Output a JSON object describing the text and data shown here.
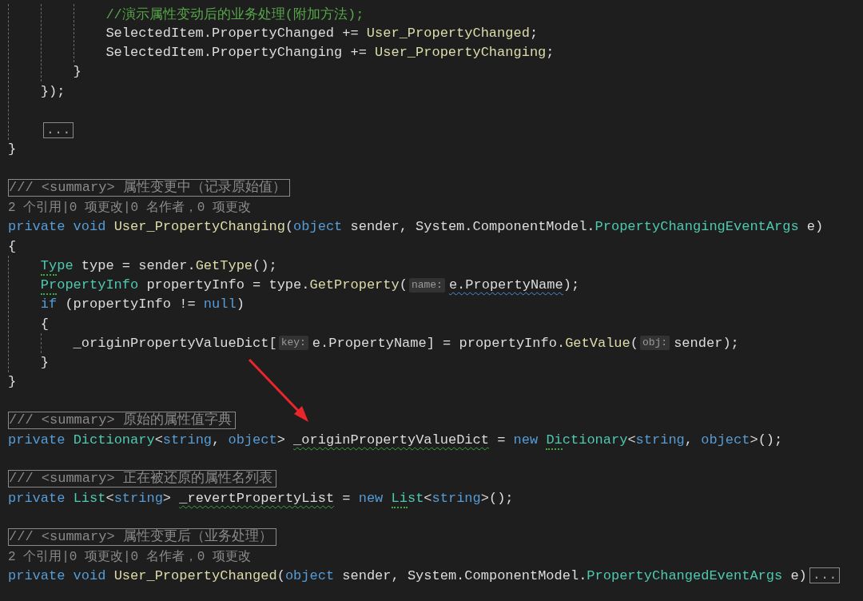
{
  "editor": {
    "lines": [
      {
        "kind": "block",
        "children": [
          {
            "kind": "block",
            "children": [
              {
                "kind": "block",
                "children": [
                  {
                    "kind": "code",
                    "tokens": [
                      {
                        "t": "//演示属性变动后的业务处理(附加方法);",
                        "kind": "comment"
                      }
                    ]
                  },
                  {
                    "kind": "code",
                    "tokens": [
                      {
                        "t": "SelectedItem.PropertyChanged += ",
                        "kind": "plain"
                      },
                      {
                        "t": "User_PropertyChanged",
                        "kind": "method"
                      },
                      {
                        "t": ";",
                        "kind": "plain"
                      }
                    ]
                  },
                  {
                    "kind": "code",
                    "tokens": [
                      {
                        "t": "SelectedItem.PropertyChanging += ",
                        "kind": "plain"
                      },
                      {
                        "t": "User_PropertyChanging",
                        "kind": "method"
                      },
                      {
                        "t": ";",
                        "kind": "plain"
                      }
                    ]
                  }
                ]
              },
              {
                "kind": "code",
                "tokens": [
                  {
                    "t": "}",
                    "kind": "plain"
                  }
                ]
              }
            ]
          },
          {
            "kind": "code",
            "tokens": [
              {
                "t": "});",
                "kind": "plain"
              }
            ]
          },
          {
            "kind": "blank"
          },
          {
            "kind": "code",
            "tokens": [
              {
                "t": "...",
                "kind": "fold"
              }
            ]
          }
        ]
      },
      {
        "kind": "code",
        "tokens": [
          {
            "t": "}",
            "kind": "plain"
          }
        ]
      },
      {
        "kind": "blank"
      },
      {
        "kind": "code",
        "tokens": [
          {
            "t": "/// <summary> 属性变更中（记录原始值）",
            "kind": "doc"
          }
        ]
      },
      {
        "kind": "code",
        "tokens": [
          {
            "t": "2 个引用|0 项更改|0 名作者，0 项更改",
            "kind": "lens"
          }
        ]
      },
      {
        "kind": "code",
        "tokens": [
          {
            "t": "private void ",
            "kind": "keyword"
          },
          {
            "t": "User_PropertyChanging",
            "kind": "method"
          },
          {
            "t": "(",
            "kind": "plain"
          },
          {
            "t": "object",
            "kind": "keyword"
          },
          {
            "t": " sender, System.ComponentModel.",
            "kind": "plain"
          },
          {
            "t": "PropertyChangingEventArgs",
            "kind": "type"
          },
          {
            "t": " e)",
            "kind": "plain"
          }
        ]
      },
      {
        "kind": "code",
        "tokens": [
          {
            "t": "{",
            "kind": "plain"
          }
        ]
      },
      {
        "kind": "block",
        "children": [
          {
            "kind": "code",
            "tokens": [
              {
                "t": "Type",
                "kind": "type",
                "suggestion_dots": true
              },
              {
                "t": " type = sender.",
                "kind": "plain"
              },
              {
                "t": "GetType",
                "kind": "method"
              },
              {
                "t": "();",
                "kind": "plain"
              }
            ]
          },
          {
            "kind": "code",
            "tokens": [
              {
                "t": "PropertyInfo",
                "kind": "type",
                "suggestion_dots": true
              },
              {
                "t": " propertyInfo = type.",
                "kind": "plain"
              },
              {
                "t": "GetProperty",
                "kind": "method"
              },
              {
                "t": "(",
                "kind": "plain"
              },
              {
                "t": "name:",
                "kind": "hint"
              },
              {
                "t": "e.PropertyName",
                "kind": "plain",
                "info_squiggle": true
              },
              {
                "t": ");",
                "kind": "plain"
              }
            ]
          },
          {
            "kind": "code",
            "tokens": [
              {
                "t": "if",
                "kind": "keyword"
              },
              {
                "t": " (propertyInfo != ",
                "kind": "plain"
              },
              {
                "t": "null",
                "kind": "keyword"
              },
              {
                "t": ")",
                "kind": "plain"
              }
            ]
          },
          {
            "kind": "code",
            "tokens": [
              {
                "t": "{",
                "kind": "plain"
              }
            ]
          },
          {
            "kind": "block",
            "children": [
              {
                "kind": "code",
                "tokens": [
                  {
                    "t": "_originPropertyValueDict[",
                    "kind": "plain"
                  },
                  {
                    "t": "key:",
                    "kind": "hint"
                  },
                  {
                    "t": "e.PropertyName] = propertyInfo.",
                    "kind": "plain"
                  },
                  {
                    "t": "GetValue",
                    "kind": "method"
                  },
                  {
                    "t": "(",
                    "kind": "plain"
                  },
                  {
                    "t": "obj:",
                    "kind": "hint"
                  },
                  {
                    "t": "sender);",
                    "kind": "plain"
                  }
                ]
              }
            ]
          },
          {
            "kind": "code",
            "tokens": [
              {
                "t": "}",
                "kind": "plain"
              }
            ]
          }
        ]
      },
      {
        "kind": "code",
        "tokens": [
          {
            "t": "}",
            "kind": "plain"
          }
        ]
      },
      {
        "kind": "blank"
      },
      {
        "kind": "code",
        "tokens": [
          {
            "t": "/// <summary> 原始的属性值字典",
            "kind": "doc"
          }
        ]
      },
      {
        "kind": "code",
        "tokens": [
          {
            "t": "private ",
            "kind": "keyword"
          },
          {
            "t": "Dictionary",
            "kind": "type"
          },
          {
            "t": "<",
            "kind": "plain"
          },
          {
            "t": "string",
            "kind": "keyword"
          },
          {
            "t": ", ",
            "kind": "plain"
          },
          {
            "t": "object",
            "kind": "keyword"
          },
          {
            "t": "> ",
            "kind": "plain"
          },
          {
            "t": "_originPropertyValueDict",
            "kind": "plain",
            "warning_squiggle": true
          },
          {
            "t": " = ",
            "kind": "plain"
          },
          {
            "t": "new ",
            "kind": "keyword"
          },
          {
            "t": "Dictionary",
            "kind": "type",
            "suggestion_dots": true
          },
          {
            "t": "<",
            "kind": "plain"
          },
          {
            "t": "string",
            "kind": "keyword"
          },
          {
            "t": ", ",
            "kind": "plain"
          },
          {
            "t": "object",
            "kind": "keyword"
          },
          {
            "t": ">();",
            "kind": "plain"
          }
        ]
      },
      {
        "kind": "blank"
      },
      {
        "kind": "code",
        "tokens": [
          {
            "t": "/// <summary> 正在被还原的属性名列表",
            "kind": "doc"
          }
        ]
      },
      {
        "kind": "code",
        "tokens": [
          {
            "t": "private ",
            "kind": "keyword"
          },
          {
            "t": "List",
            "kind": "type"
          },
          {
            "t": "<",
            "kind": "plain"
          },
          {
            "t": "string",
            "kind": "keyword"
          },
          {
            "t": "> ",
            "kind": "plain"
          },
          {
            "t": "_revertPropertyList",
            "kind": "plain",
            "warning_squiggle": true
          },
          {
            "t": " = ",
            "kind": "plain"
          },
          {
            "t": "new ",
            "kind": "keyword"
          },
          {
            "t": "List",
            "kind": "type",
            "suggestion_dots": true
          },
          {
            "t": "<",
            "kind": "plain"
          },
          {
            "t": "string",
            "kind": "keyword"
          },
          {
            "t": ">();",
            "kind": "plain"
          }
        ]
      },
      {
        "kind": "blank"
      },
      {
        "kind": "code",
        "tokens": [
          {
            "t": "/// <summary> 属性变更后（业务处理）",
            "kind": "doc"
          }
        ]
      },
      {
        "kind": "code",
        "tokens": [
          {
            "t": "2 个引用|0 项更改|0 名作者，0 项更改",
            "kind": "lens"
          }
        ]
      },
      {
        "kind": "code",
        "tokens": [
          {
            "t": "private void ",
            "kind": "keyword"
          },
          {
            "t": "User_PropertyChanged",
            "kind": "method"
          },
          {
            "t": "(",
            "kind": "plain"
          },
          {
            "t": "object",
            "kind": "keyword"
          },
          {
            "t": " sender, System.ComponentModel.",
            "kind": "plain"
          },
          {
            "t": "PropertyChangedEventArgs",
            "kind": "type"
          },
          {
            "t": " e)",
            "kind": "plain"
          },
          {
            "t": "...",
            "kind": "fold"
          }
        ]
      }
    ]
  }
}
